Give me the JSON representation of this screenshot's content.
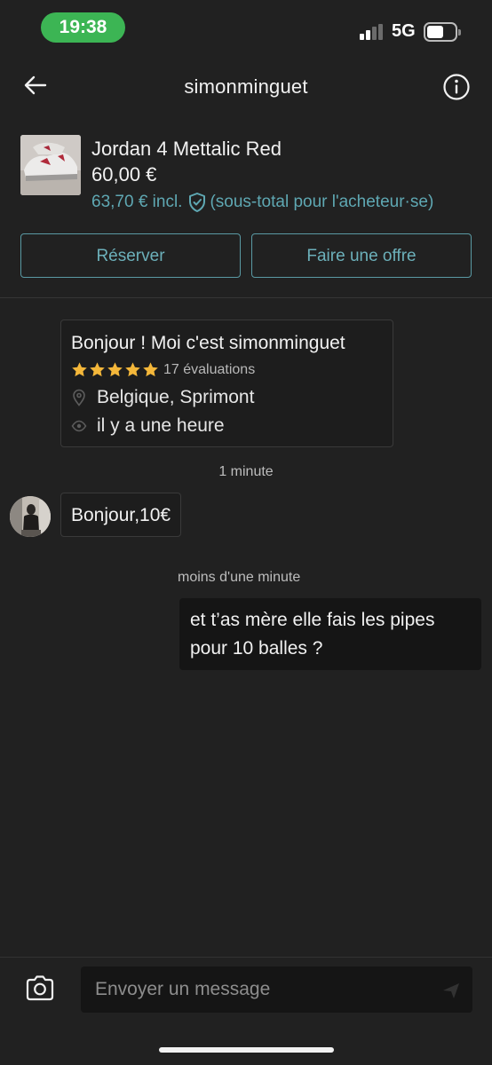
{
  "status_bar": {
    "time": "19:38",
    "network": "5G",
    "icons": [
      "signal-icon",
      "battery-icon"
    ]
  },
  "header": {
    "username": "simonminguet",
    "icons": [
      "back-arrow-icon",
      "info-icon"
    ]
  },
  "item": {
    "title": "Jordan 4 Mettalic Red",
    "price": "60,00 €",
    "incl_price": "63,70 € incl.",
    "buyer_note": "(sous-total pour l'acheteur·se)",
    "shield_icon": "buyer-protection-shield-icon"
  },
  "actions": {
    "reserve_label": "Réserver",
    "offer_label": "Faire une offre"
  },
  "profile_card": {
    "greeting": "Bonjour ! Moi c'est simonminguet",
    "rating": 5,
    "reviews": "17 évaluations",
    "location": "Belgique, Sprimont",
    "last_seen": "il y a une heure"
  },
  "messages": [
    {
      "time": "1 minute",
      "from": "other",
      "text": "Bonjour,10€"
    },
    {
      "time": "moins d'une minute",
      "from": "me",
      "text": "et t’as mère elle fais les pipes pour 10 balles ?"
    }
  ],
  "composer": {
    "placeholder": "Envoyer un message"
  },
  "colors": {
    "background": "#212121",
    "accent": "#5fa8b3",
    "status_green": "#3cb554",
    "star": "#f4b73a"
  }
}
